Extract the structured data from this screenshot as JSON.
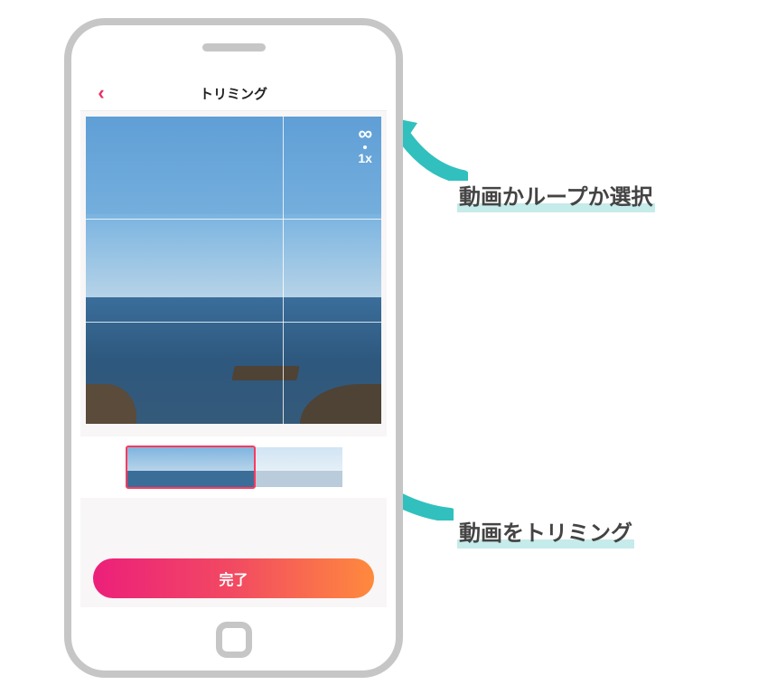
{
  "header": {
    "title": "トリミング",
    "back_icon": "chevron-left"
  },
  "preview": {
    "grid": "rule-of-thirds",
    "mode_column": {
      "loop_icon": "infinity",
      "speed_label": "1x"
    }
  },
  "timeline": {
    "selected_fraction": 0.6
  },
  "actions": {
    "done_label": "完了"
  },
  "annotations": {
    "arrow1_label": "動画かループか選択",
    "arrow2_label": "動画をトリミング"
  },
  "colors": {
    "accent_gradient_start": "#ec1f7a",
    "accent_gradient_end": "#ff8a3d",
    "back_arrow": "#e9305f",
    "annotation_arrow": "#31c0be",
    "annotation_underline": "#c5ebea"
  }
}
